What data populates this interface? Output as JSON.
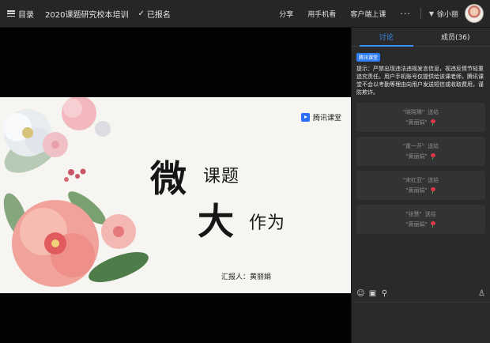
{
  "topbar": {
    "menu_label": "目录",
    "course_title": "2020课题研究校本培训",
    "signed_label": "已报名",
    "links": [
      "分享",
      "用手机看",
      "客户端上课"
    ],
    "more_label": "···",
    "user_name": "徐小丽"
  },
  "slide": {
    "brand": "腾讯课堂",
    "title_big_1": "微",
    "title_small_1": "课题",
    "title_big_2": "大",
    "title_small_2": "作为",
    "reporter": "汇报人：黄丽娟"
  },
  "panel": {
    "tabs": [
      "讨论",
      "成员(36)"
    ],
    "notice_badge": "腾讯课堂",
    "notice_text": "提示：严禁出现违法违规发言信息，视违反情节轻重追究责任。用户手机账号仅提供给该课老师，腾讯课堂不会以考勤等理由向用户发送短信或收取费用，谨防欺诈。",
    "gifts": [
      {
        "sender": "\"晓晓琳\"",
        "verb": "送给",
        "receiver": "\"黄丽娟\""
      },
      {
        "sender": "\"重一开\"",
        "verb": "送给",
        "receiver": "\"黄丽娟\""
      },
      {
        "sender": "\"宋红亚\"",
        "verb": "送给",
        "receiver": "\"黄丽娟\""
      },
      {
        "sender": "\"张慧\"",
        "verb": "送给",
        "receiver": "\"黄丽娟\""
      }
    ]
  },
  "colors": {
    "accent": "#3a8ef8",
    "topbar_bg": "#262626",
    "panel_bg": "#2a2a2a",
    "slide_bg": "#f6f5f1"
  },
  "icons": [
    "hamburger-icon",
    "check-icon",
    "chevron-down-icon",
    "emoji-icon",
    "image-icon",
    "gift-icon",
    "hand-raise-icon",
    "flower-icon"
  ]
}
